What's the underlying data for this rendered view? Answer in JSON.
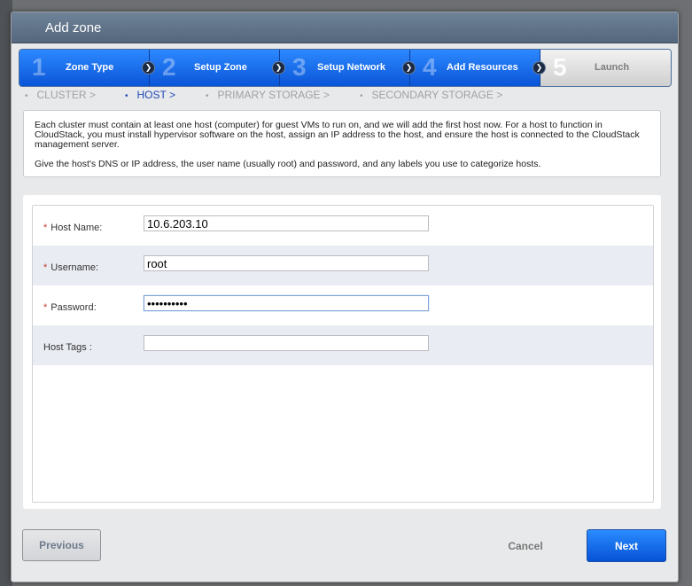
{
  "dialog": {
    "title": "Add zone"
  },
  "steps": [
    {
      "number": "1",
      "label": "Zone Type",
      "state": "done"
    },
    {
      "number": "2",
      "label": "Setup Zone",
      "state": "done"
    },
    {
      "number": "3",
      "label": "Setup Network",
      "state": "done"
    },
    {
      "number": "4",
      "label": "Add Resources",
      "state": "active"
    },
    {
      "number": "5",
      "label": "Launch",
      "state": "inactive"
    }
  ],
  "substeps": [
    {
      "label": "CLUSTER >",
      "active": false
    },
    {
      "label": "HOST >",
      "active": true
    },
    {
      "label": "PRIMARY STORAGE >",
      "active": false
    },
    {
      "label": "SECONDARY STORAGE >",
      "active": false
    }
  ],
  "info": {
    "paragraph1": "Each cluster must contain at least one host (computer) for guest VMs to run on, and we will add the first host now. For a host to function in CloudStack, you must install hypervisor software on the host, assign an IP address to the host, and ensure the host is connected to the CloudStack management server.",
    "paragraph2": "Give the host's DNS or IP address, the user name (usually root) and password, and any labels you use to categorize hosts."
  },
  "form": {
    "host_name": {
      "label": "Host Name:",
      "required": true,
      "value": "10.6.203.10"
    },
    "username": {
      "label": "Username:",
      "required": true,
      "value": "root"
    },
    "password": {
      "label": "Password:",
      "required": true,
      "value": "••••••••••"
    },
    "host_tags": {
      "label": "Host Tags :",
      "required": false,
      "value": ""
    }
  },
  "buttons": {
    "previous": "Previous",
    "cancel": "Cancel",
    "next": "Next"
  },
  "icons": {
    "step_arrow": "chevron-right-icon",
    "substep_bullet": "bullet-icon"
  },
  "colors": {
    "step_active": "#0a55d8",
    "title_bar": "#5f7389",
    "required_marker": "#c0392b",
    "substep_active": "#2048b8"
  }
}
